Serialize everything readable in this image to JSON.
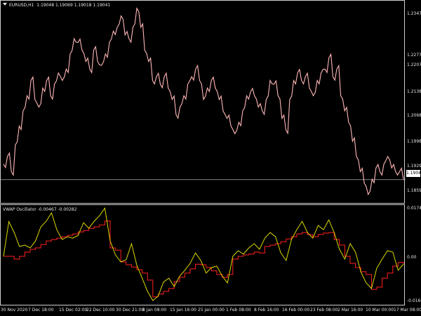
{
  "main_chart": {
    "symbol_title": "EURUSD,H1",
    "ohlc": "1.19048 1.19069 1.19018 1.19041",
    "current_price": "1.19041",
    "price_labels": [
      "1.23470",
      "1.22770",
      "1.22070",
      "1.21380",
      "1.20680",
      "1.19980",
      "1.19290",
      "1.18590"
    ],
    "price_min": 1.1839,
    "price_max": 1.2375,
    "series_color": "#ffb6b6",
    "close_series": [
      1.1945,
      1.1965,
      1.1925,
      1.1995,
      1.2045,
      1.2085,
      1.2125,
      1.2165,
      1.2115,
      1.2095,
      1.2145,
      1.2165,
      1.2125,
      1.2155,
      1.2185,
      1.2165,
      1.2195,
      1.2235,
      1.2275,
      1.2265,
      1.2245,
      1.2215,
      1.2195,
      1.2245,
      1.2215,
      1.2205,
      1.2235,
      1.2265,
      1.2295,
      1.2305,
      1.2335,
      1.2285,
      1.2275,
      1.2305,
      1.2355,
      1.2305,
      1.2245,
      1.2215,
      1.2165,
      1.2175,
      1.2155,
      1.2175,
      1.2145,
      1.2115,
      1.2075,
      1.2095,
      1.2125,
      1.2155,
      1.2175,
      1.2195,
      1.2165,
      1.2115,
      1.2145,
      1.2165,
      1.2145,
      1.2115,
      1.2085,
      1.2065,
      1.2045,
      1.2025,
      1.2055,
      1.2085,
      1.2125,
      1.2135,
      1.2125,
      1.2095,
      1.2085,
      1.2115,
      1.2165,
      1.2155,
      1.2125,
      1.2065,
      1.2035,
      1.2115,
      1.2165,
      1.2185,
      1.2165,
      1.2175,
      1.2145,
      1.2125,
      1.2165,
      1.2185,
      1.2195,
      1.2225,
      1.2175,
      1.2195,
      1.2125,
      1.2085,
      1.2055,
      1.2005,
      1.1965,
      1.1925,
      1.1895,
      1.1865,
      1.1905,
      1.1935,
      1.1925,
      1.1945,
      1.1965,
      1.1935,
      1.1925,
      1.1925,
      1.1905
    ],
    "last_price_line": 1.19041
  },
  "oscillator": {
    "title": "VWAP Oscillator",
    "values_text": "-0.00467 -0.00282",
    "labels": [
      "0.01743",
      "0.00",
      "-0.01645"
    ],
    "min": -0.0178,
    "max": 0.0183,
    "yellow_color": "#d9d900",
    "red_color": "#ff2020",
    "yellow_series": [
      0.0,
      0.0124,
      0.0085,
      0.0035,
      0.004,
      0.003,
      0.0055,
      0.0105,
      0.0125,
      0.0155,
      0.0095,
      0.006,
      0.007,
      0.0065,
      0.0075,
      0.012,
      0.01,
      0.0125,
      0.0145,
      0.0172,
      0.0055,
      0.0005,
      -0.002,
      -0.0012,
      0.0045,
      -0.0032,
      -0.0078,
      -0.0125,
      -0.0158,
      -0.0142,
      -0.0092,
      -0.0078,
      -0.0108,
      -0.0072,
      -0.005,
      -0.0025,
      0.0012,
      -0.0015,
      -0.006,
      -0.004,
      -0.0035,
      -0.007,
      -0.0095,
      0.0,
      0.002,
      0.0008,
      0.003,
      0.0045,
      0.0025,
      0.0065,
      0.0085,
      0.007,
      0.0012,
      -0.0015,
      0.006,
      0.0095,
      0.0125,
      0.0085,
      0.0065,
      0.011,
      0.0095,
      0.013,
      0.0085,
      0.0025,
      -0.001,
      0.0045,
      0.0015,
      -0.0055,
      -0.0095,
      -0.0115,
      -0.0042,
      -0.001,
      0.002,
      0.0015,
      -0.005,
      -0.0028
    ],
    "red_series": [
      0.0,
      0.0,
      -0.001,
      0.0,
      0.0015,
      0.0025,
      0.003,
      0.0042,
      0.0055,
      0.006,
      0.0065,
      0.007,
      0.0075,
      0.008,
      0.0087,
      0.0092,
      0.01,
      0.0105,
      0.0112,
      0.0126,
      0.003,
      0.0022,
      -0.002,
      -0.003,
      -0.0038,
      -0.0048,
      -0.006,
      -0.0085,
      -0.0145,
      -0.0135,
      -0.0125,
      -0.0115,
      -0.009,
      -0.0075,
      -0.006,
      -0.0045,
      -0.0028,
      -0.003,
      -0.004,
      -0.0052,
      -0.0065,
      -0.0075,
      -0.0065,
      -0.001,
      0.0,
      0.0005,
      0.0008,
      0.0015,
      0.0012,
      0.0035,
      0.004,
      0.0045,
      0.0052,
      0.0062,
      0.007,
      0.008,
      0.0085,
      0.0077,
      0.007,
      0.0078,
      0.0083,
      0.0085,
      0.006,
      0.004,
      0.0,
      -0.0025,
      -0.004,
      -0.0055,
      -0.0065,
      -0.0118,
      -0.011,
      -0.0078,
      -0.006,
      -0.0035,
      -0.0022,
      -0.0028
    ]
  },
  "time_axis": {
    "labels": [
      "30 Nov 2020",
      "7 Dec 18:00",
      "15 Dec 02:00",
      "22 Dec 10:00",
      "30 Dec 21:00",
      "8 Jan 08:00",
      "15 Jan 16:00",
      "25 Jan 00:00",
      "1 Feb 08:00",
      "8 Feb 16:00",
      "16 Feb 00:00",
      "23 Feb 08:00",
      "2 Mar 16:00",
      "10 Mar 00:00",
      "17 Mar 08:00"
    ]
  }
}
